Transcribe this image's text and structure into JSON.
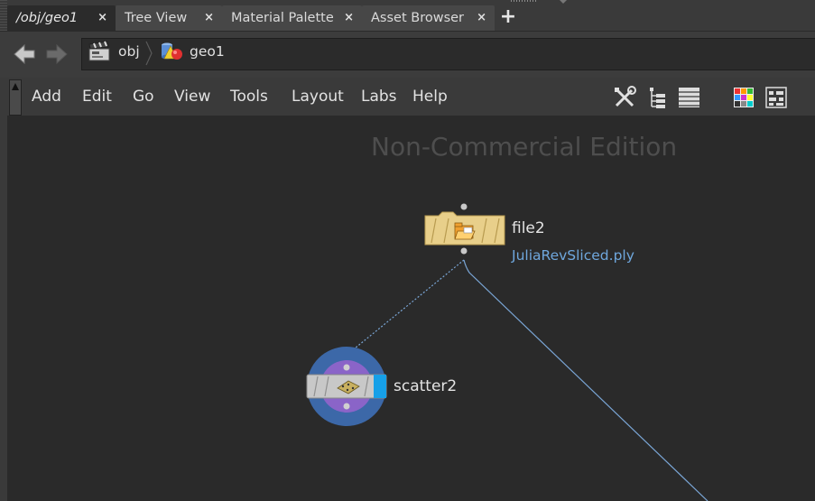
{
  "tabs": [
    {
      "label": "/obj/geo1",
      "close": "×"
    },
    {
      "label": "Tree View",
      "close": "×"
    },
    {
      "label": "Material Palette",
      "close": "×"
    },
    {
      "label": "Asset Browser",
      "close": "×"
    }
  ],
  "tab_add": "+",
  "path": {
    "crumbs": [
      {
        "label": "obj",
        "icon": "clapperboard-icon"
      },
      {
        "label": "geo1",
        "icon": "geometry-object-icon"
      }
    ]
  },
  "menu": {
    "items": [
      "Add",
      "Edit",
      "Go",
      "View",
      "Tools",
      "Layout",
      "Labs",
      "Help"
    ],
    "tools": [
      "wrench-icon",
      "tree-list-icon",
      "list-view-icon",
      "color-grid-icon",
      "layout-icon"
    ]
  },
  "network": {
    "watermark": "Non-Commercial Edition",
    "nodes": [
      {
        "name": "file2",
        "subtitle": "JuliaRevSliced.ply",
        "icon": "folder-icon"
      },
      {
        "name": "scatter2",
        "subtitle": "",
        "icon": "scatter-icon"
      }
    ]
  },
  "colors": {
    "canvas_bg": "#2a2a2a",
    "file_node": "#e8cf8a",
    "scatter_ring_outer": "#3c68a8",
    "scatter_ring_inner": "#8a64c8",
    "display_flag": "#16a0e8",
    "wire": "#7aa6d6"
  }
}
